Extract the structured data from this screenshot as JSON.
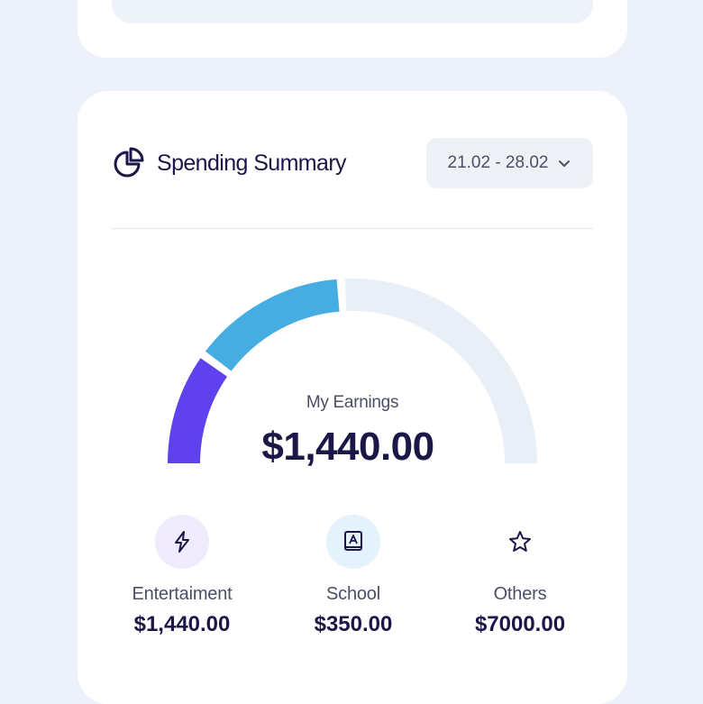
{
  "summary": {
    "title": "Spending Summary",
    "date_range": "21.02 - 28.02",
    "earnings_label": "My Earnings",
    "earnings_value": "$1,440.00"
  },
  "gauge": {
    "segments": [
      {
        "name": "purple-segment",
        "fraction": 0.2,
        "color": "#6041ee"
      },
      {
        "name": "blue-segment",
        "fraction": 0.28,
        "color": "#45ade2"
      },
      {
        "name": "remaining-segment",
        "fraction": 0.52,
        "color": "#e9eff6"
      }
    ]
  },
  "categories": [
    {
      "label": "Entertaiment",
      "value": "$1,440.00",
      "icon": "lightning-icon",
      "icon_bg": "#efebfd"
    },
    {
      "label": "School",
      "value": "$350.00",
      "icon": "book-icon",
      "icon_bg": "#e4f3fb"
    },
    {
      "label": "Others",
      "value": "$7000.00",
      "icon": "star-icon",
      "icon_bg": "#ffffff"
    }
  ]
}
